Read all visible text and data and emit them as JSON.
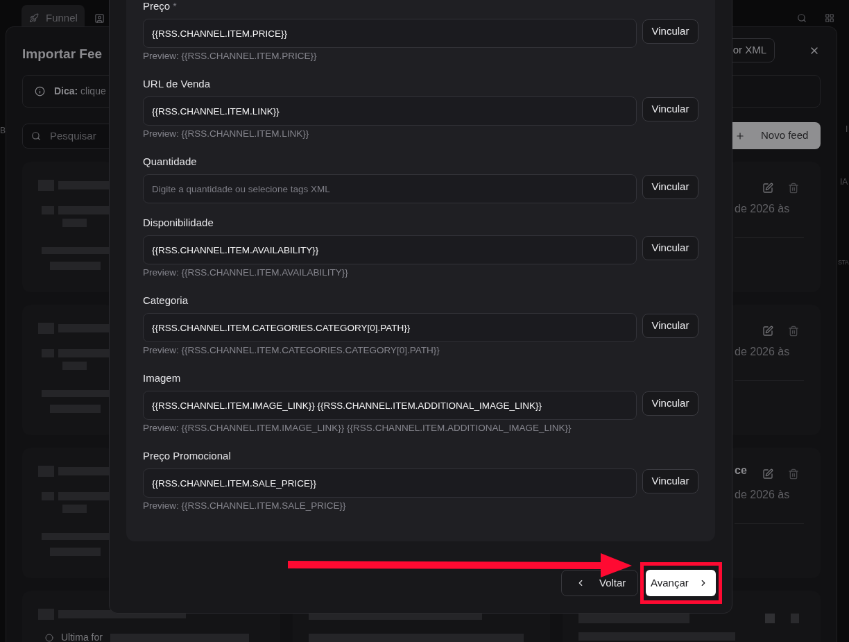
{
  "app_bar": {
    "tabs": [
      {
        "kind": "labeled",
        "label": "Funnel",
        "selected": true
      },
      {
        "kind": "icon",
        "selected": false
      }
    ]
  },
  "page_edges": {
    "left": [
      "B"
    ],
    "right": [
      "I",
      "IA",
      "STA"
    ]
  },
  "feeds_dialog": {
    "title": "Importar Fee",
    "xml_button": "or XML",
    "hint": "**Dica:** clique",
    "search": {
      "placeholder": "Pesquisar"
    },
    "new_feed_button": "Novo feed",
    "cards": [
      {
        "text_line": "de 2026 às"
      },
      {
        "text_line": "de 2026 às"
      },
      {
        "title": "ce",
        "text_line": "de 2026 às"
      }
    ],
    "last_row_card": {
      "text_line": "Ultima for"
    }
  },
  "mapping_dialog": {
    "fields": [
      {
        "label": "Preço",
        "required_mark": "*",
        "value": "{{RSS.CHANNEL.ITEM.PRICE}}",
        "button": "Vincular",
        "preview": "Preview: {{RSS.CHANNEL.ITEM.PRICE}}"
      },
      {
        "label": "URL de Venda",
        "value": "{{RSS.CHANNEL.ITEM.LINK}}",
        "button": "Vincular",
        "preview": "Preview: {{RSS.CHANNEL.ITEM.LINK}}"
      },
      {
        "label": "Quantidade",
        "placeholder": "Digite a quantidade ou selecione tags XML",
        "button": "Vincular"
      },
      {
        "label": "Disponibilidade",
        "value": "{{RSS.CHANNEL.ITEM.AVAILABILITY}}",
        "button": "Vincular",
        "preview": "Preview: {{RSS.CHANNEL.ITEM.AVAILABILITY}}"
      },
      {
        "label": "Categoria",
        "value": "{{RSS.CHANNEL.ITEM.CATEGORIES.CATEGORY[0].PATH}}",
        "button": "Vincular",
        "preview": "Preview: {{RSS.CHANNEL.ITEM.CATEGORIES.CATEGORY[0].PATH}}"
      },
      {
        "label": "Imagem",
        "value": "{{RSS.CHANNEL.ITEM.IMAGE_LINK}} {{RSS.CHANNEL.ITEM.ADDITIONAL_IMAGE_LINK}}",
        "button": "Vincular",
        "preview": "Preview: {{RSS.CHANNEL.ITEM.IMAGE_LINK}} {{RSS.CHANNEL.ITEM.ADDITIONAL_IMAGE_LINK}}"
      },
      {
        "label": "Preço Promocional",
        "value": "{{RSS.CHANNEL.ITEM.SALE_PRICE}}",
        "button": "Vincular",
        "preview": "Preview: {{RSS.CHANNEL.ITEM.SALE_PRICE}}"
      }
    ],
    "footer": {
      "back_button": "Voltar",
      "next_button": {
        "label": "Avançar",
        "highlighted": true
      }
    }
  }
}
